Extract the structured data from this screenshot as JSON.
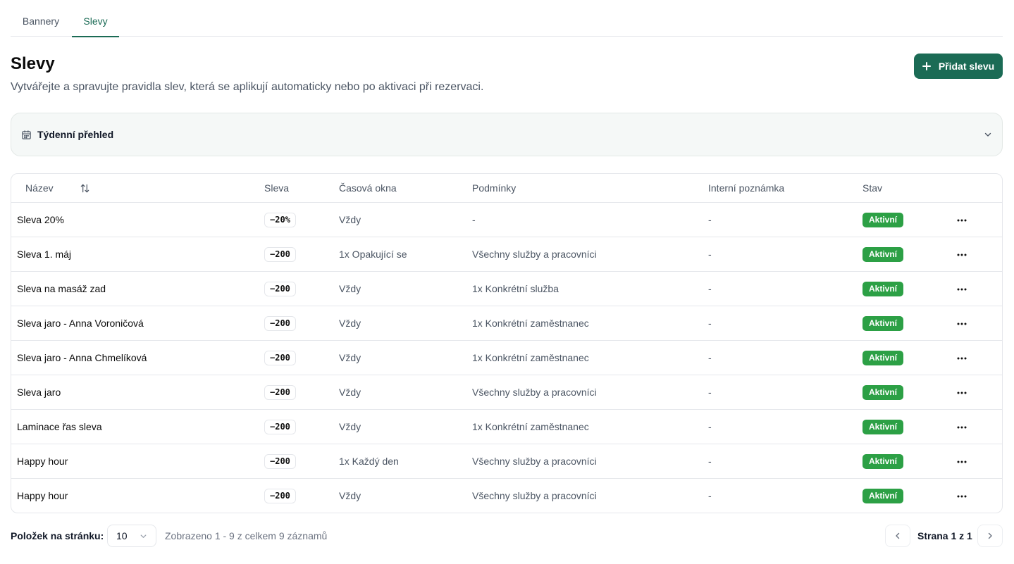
{
  "tabs": [
    {
      "label": "Bannery",
      "active": false
    },
    {
      "label": "Slevy",
      "active": true
    }
  ],
  "header": {
    "title": "Slevy",
    "subtitle": "Vytvářejte a spravujte pravidla slev, která se aplikují automaticky nebo po aktivaci při rezervaci.",
    "add_button_label": "Přidat slevu"
  },
  "overview": {
    "label": "Týdenní přehled",
    "icon": "calendar-icon",
    "expand_icon": "chevron-down-icon"
  },
  "table": {
    "columns": {
      "name": "Název",
      "discount": "Sleva",
      "time_windows": "Časová okna",
      "conditions": "Podmínky",
      "note": "Interní poznámka",
      "status": "Stav"
    },
    "rows": [
      {
        "name": "Sleva 20%",
        "discount": "−20%",
        "time_windows": "Vždy",
        "conditions": "-",
        "note": "-",
        "status": "Aktivní"
      },
      {
        "name": "Sleva 1. máj",
        "discount": "−200",
        "time_windows": "1x Opakující se",
        "conditions": "Všechny služby a pracovníci",
        "note": "-",
        "status": "Aktivní"
      },
      {
        "name": "Sleva na masáž zad",
        "discount": "−200",
        "time_windows": "Vždy",
        "conditions": "1x Konkrétní služba",
        "note": "-",
        "status": "Aktivní"
      },
      {
        "name": "Sleva jaro - Anna Voroničová",
        "discount": "−200",
        "time_windows": "Vždy",
        "conditions": "1x Konkrétní zaměstnanec",
        "note": "-",
        "status": "Aktivní"
      },
      {
        "name": "Sleva jaro - Anna Chmelíková",
        "discount": "−200",
        "time_windows": "Vždy",
        "conditions": "1x Konkrétní zaměstnanec",
        "note": "-",
        "status": "Aktivní"
      },
      {
        "name": "Sleva jaro",
        "discount": "−200",
        "time_windows": "Vždy",
        "conditions": "Všechny služby a pracovníci",
        "note": "-",
        "status": "Aktivní"
      },
      {
        "name": "Laminace řas sleva",
        "discount": "−200",
        "time_windows": "Vždy",
        "conditions": "1x Konkrétní zaměstnanec",
        "note": "-",
        "status": "Aktivní"
      },
      {
        "name": "Happy hour",
        "discount": "−200",
        "time_windows": "1x Každý den",
        "conditions": "Všechny služby a pracovníci",
        "note": "-",
        "status": "Aktivní"
      },
      {
        "name": "Happy hour",
        "discount": "−200",
        "time_windows": "Vždy",
        "conditions": "Všechny služby a pracovníci",
        "note": "-",
        "status": "Aktivní"
      }
    ]
  },
  "footer": {
    "page_size_label": "Položek na stránku:",
    "page_size_value": "10",
    "info": "Zobrazeno 1 - 9 z celkem 9 záznamů",
    "page_text": "Strana 1 z 1"
  },
  "colors": {
    "primary": "#1b6b55",
    "status_active": "#2ca045",
    "border": "#e5e7eb",
    "overview_bg": "#f5f8f7"
  }
}
